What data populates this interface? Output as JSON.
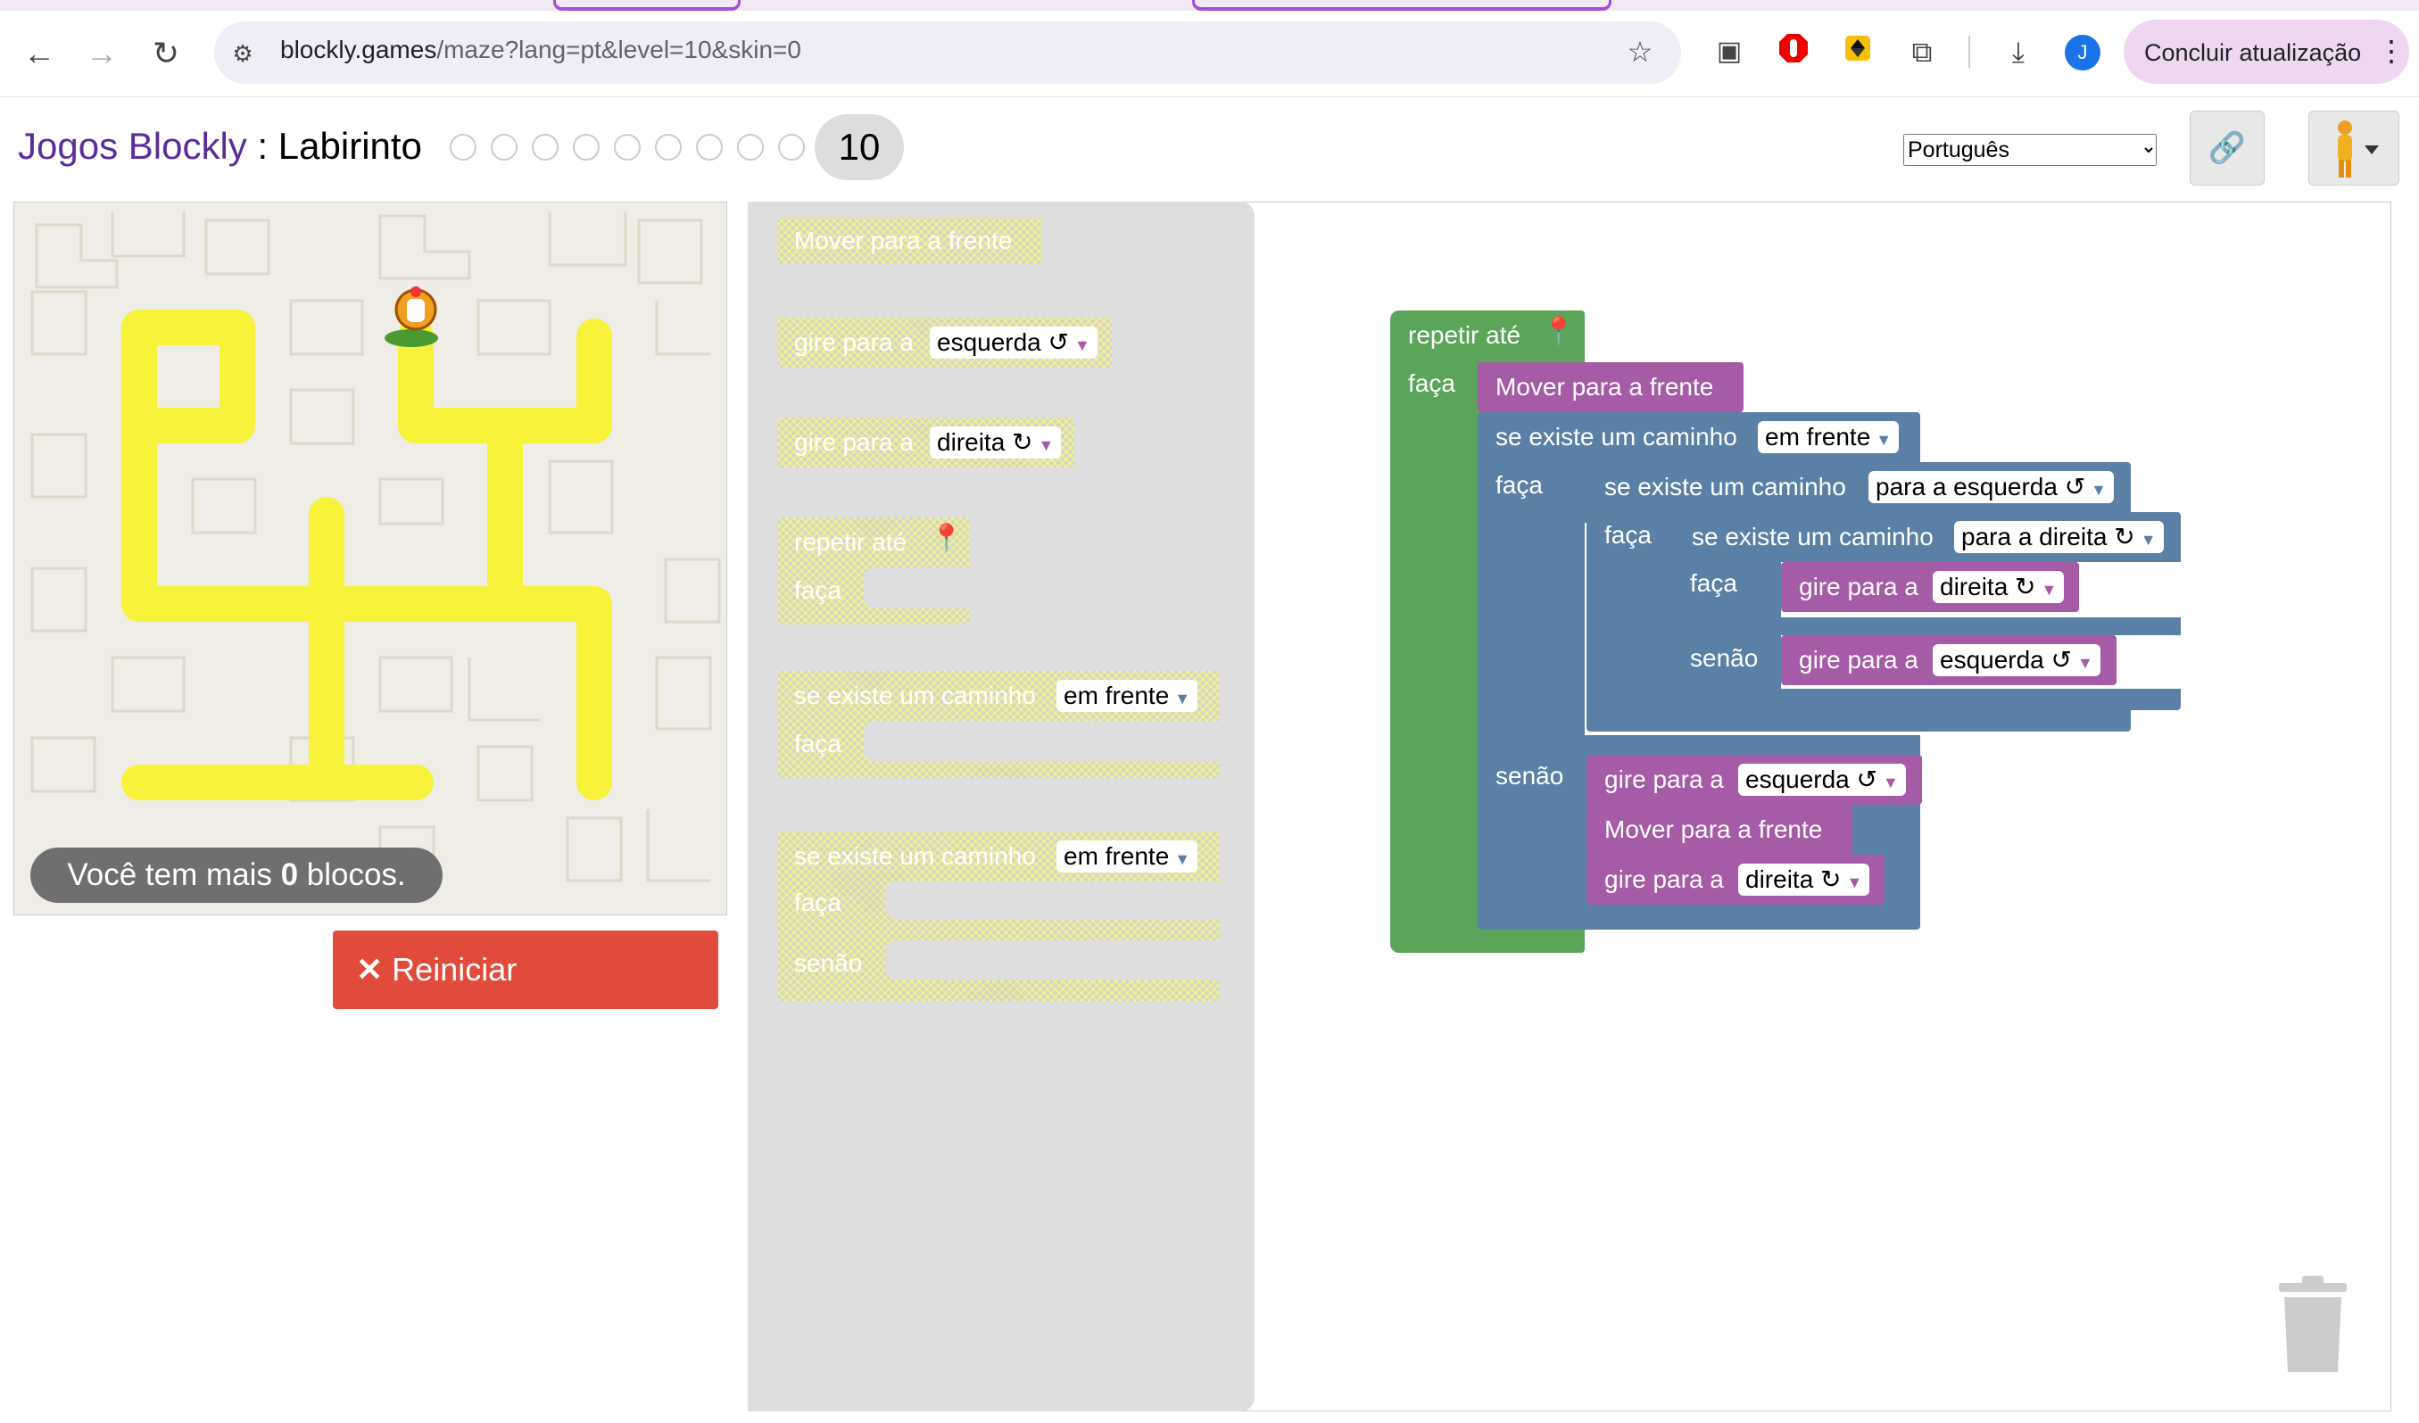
{
  "browser": {
    "url_host": "blockly.games",
    "url_path": "/maze?lang=pt&level=10&skin=0",
    "profile_initial": "J",
    "update_button": "Concluir atualização",
    "icons": [
      "back-icon",
      "forward-icon",
      "reload-icon",
      "site-info-icon",
      "star-icon",
      "picture-in-picture-icon",
      "adblock-icon",
      "extension-icon",
      "puzzle-icon",
      "download-icon",
      "more-icon"
    ]
  },
  "header": {
    "app_link": "Jogos Blockly",
    "separator": " : ",
    "game": "Labirinto",
    "current_level": "10",
    "language": "Português",
    "language_options": [
      "Português"
    ]
  },
  "maze": {
    "blocks_left_prefix": "Você tem mais ",
    "blocks_left_count": "0",
    "blocks_left_suffix": " blocos.",
    "reset_label": "Reiniciar"
  },
  "toolbox": {
    "move_forward": "Mover para a frente",
    "turn_prefix": "gire para a",
    "left": "esquerda ↺",
    "right": "direita ↻",
    "repeat_until": "repetir até",
    "do": "faça",
    "else": "senão",
    "if_path": "se existe um caminho",
    "ahead": "em frente"
  },
  "program": {
    "repeat_until": "repetir até",
    "do": "faça",
    "move_forward": "Mover para a frente",
    "if_path": "se existe um caminho",
    "ahead": "em frente",
    "to_left": "para a esquerda ↺",
    "to_right": "para a direita ↻",
    "turn_prefix": "gire para a",
    "right": "direita ↻",
    "left": "esquerda ↺",
    "else": "senão"
  },
  "colors": {
    "motion": "#a55ba5",
    "logic": "#5b80a5",
    "loop": "#5ba55b",
    "reset": "#e14b3c",
    "path": "#ffff33"
  }
}
